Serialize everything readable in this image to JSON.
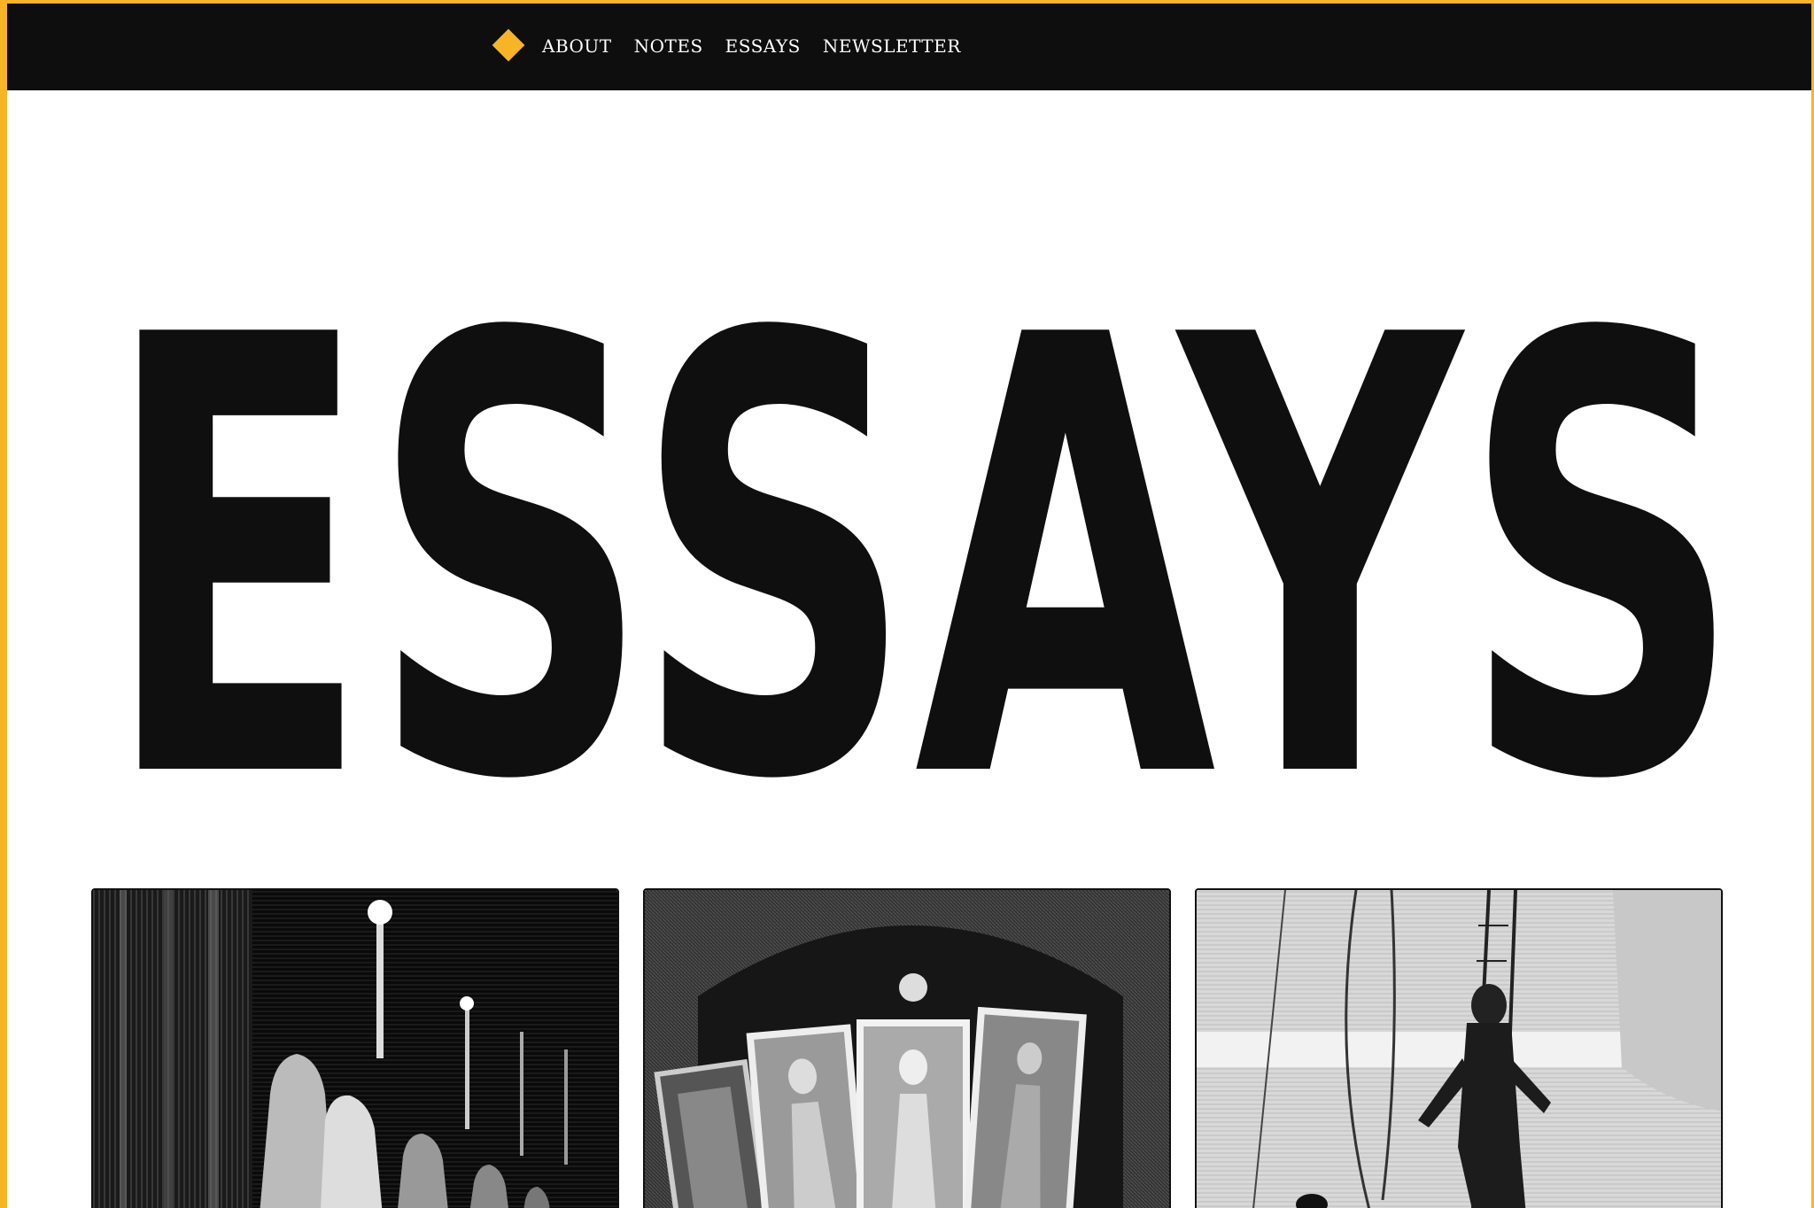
{
  "nav": {
    "logo_color": "#f7b526",
    "links": [
      {
        "label": "ABOUT"
      },
      {
        "label": "NOTES"
      },
      {
        "label": "ESSAYS"
      },
      {
        "label": "NEWSLETTER"
      }
    ]
  },
  "hero": {
    "title": "ESSAYS"
  },
  "colors": {
    "frame": "#f7b526",
    "nav_background": "#0e0e0e",
    "page_background": "#ffffff",
    "text": "#0f0f0f"
  },
  "cards": [
    {
      "illustration": "hooded-figures-with-candles-engraving"
    },
    {
      "illustration": "framed-portraits-in-archway-engraving"
    },
    {
      "illustration": "man-on-ship-deck-engraving"
    }
  ]
}
